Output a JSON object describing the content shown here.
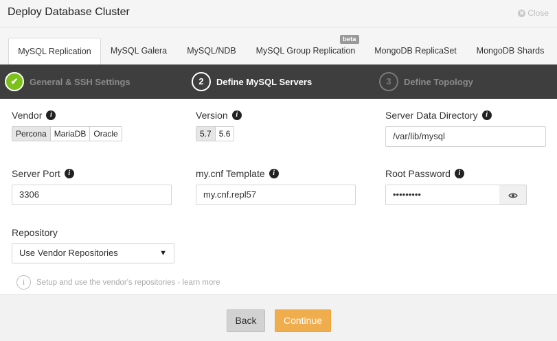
{
  "header": {
    "title": "Deploy Database Cluster",
    "close_label": "Close"
  },
  "tabs": [
    {
      "label": "MySQL Replication",
      "active": true
    },
    {
      "label": "MySQL Galera",
      "active": false
    },
    {
      "label": "MySQL/NDB",
      "active": false
    },
    {
      "label": "MySQL Group Replication",
      "active": false,
      "badge": "beta"
    },
    {
      "label": "MongoDB ReplicaSet",
      "active": false
    },
    {
      "label": "MongoDB Shards",
      "active": false
    }
  ],
  "steps": [
    {
      "number": "✔",
      "label": "General & SSH Settings",
      "state": "done"
    },
    {
      "number": "2",
      "label": "Define MySQL Servers",
      "state": "current"
    },
    {
      "number": "3",
      "label": "Define Topology",
      "state": "pending"
    }
  ],
  "form": {
    "vendor": {
      "label": "Vendor",
      "options": [
        "Percona",
        "MariaDB",
        "Oracle"
      ],
      "selected": "Percona"
    },
    "version": {
      "label": "Version",
      "options": [
        "5.7",
        "5.6"
      ],
      "selected": "5.7"
    },
    "data_dir": {
      "label": "Server Data Directory",
      "value": "/var/lib/mysql"
    },
    "port": {
      "label": "Server Port",
      "value": "3306"
    },
    "template": {
      "label": "my.cnf Template",
      "value": "my.cnf.repl57"
    },
    "root_password": {
      "label": "Root Password",
      "value": "•••••••••"
    },
    "repository": {
      "label": "Repository",
      "value": "Use Vendor Repositories"
    },
    "hint": "Setup and use the vendor's repositories - learn more",
    "info_glyph": "i"
  },
  "footer": {
    "back_label": "Back",
    "continue_label": "Continue"
  },
  "colors": {
    "step_done": "#7cc11a",
    "continue": "#f0ad4e",
    "steps_bar": "#3e3e3e"
  }
}
